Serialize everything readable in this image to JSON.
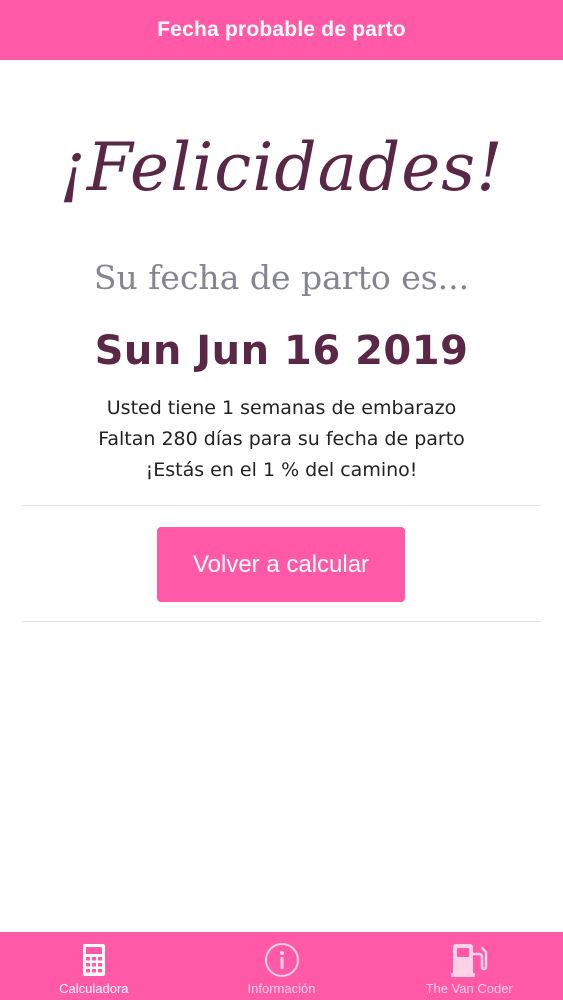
{
  "header": {
    "title": "Fecha probable de parto"
  },
  "result": {
    "headline": "¡Felicidades!",
    "subtitle": "Su fecha de parto es...",
    "due_date": "Sun Jun 16 2019",
    "line1": "Usted tiene 1 semanas de embarazo",
    "line2": "Faltan 280 días para su fecha de parto",
    "line3": "¡Estás en el 1 % del camino!"
  },
  "actions": {
    "recalculate_label": "Volver a calcular"
  },
  "tabbar": {
    "tabs": [
      {
        "label": "Calculadora",
        "icon": "calculator-icon",
        "active": true
      },
      {
        "label": "Información",
        "icon": "info-icon",
        "active": false
      },
      {
        "label": "The Van Coder",
        "icon": "fuel-pump-icon",
        "active": false
      }
    ]
  },
  "colors": {
    "accent": "#ff59a8",
    "headline": "#5a2846",
    "subtitle": "#858592"
  }
}
